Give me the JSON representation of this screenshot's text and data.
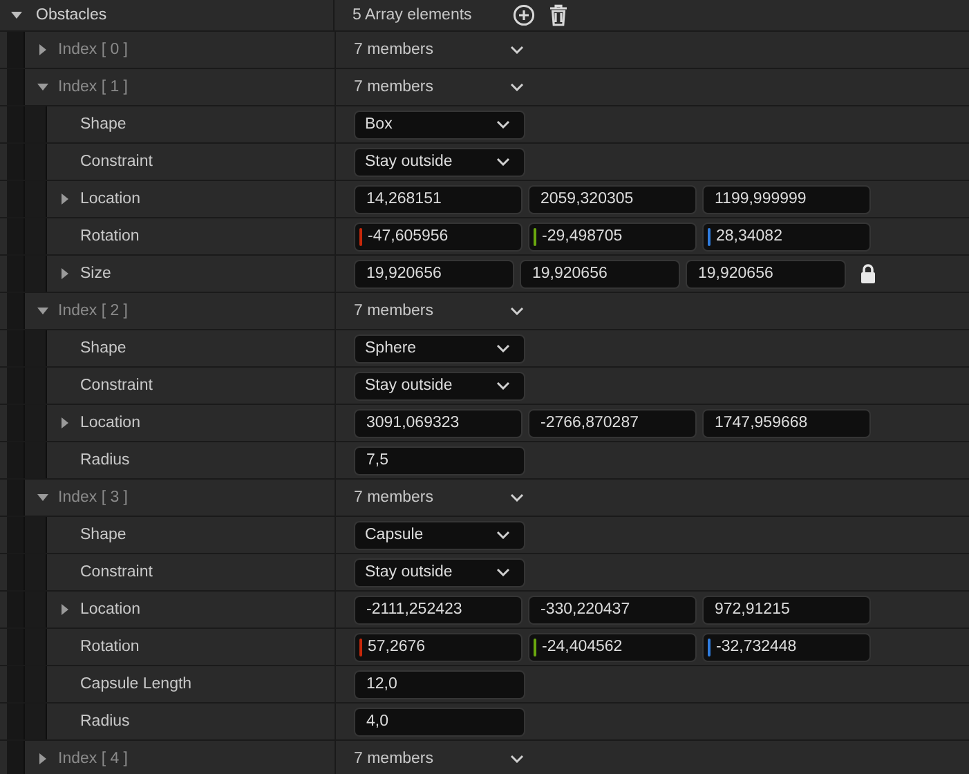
{
  "obstacles": {
    "label": "Obstacles",
    "expanded": true,
    "summary": "5 Array elements",
    "elements": [
      {
        "label": "Index [ 0 ]",
        "summary": "7 members",
        "expanded": false
      },
      {
        "label": "Index [ 1 ]",
        "summary": "7 members",
        "expanded": true,
        "members": [
          {
            "label": "Shape",
            "kind": "dropdown",
            "value": "Box"
          },
          {
            "label": "Constraint",
            "kind": "dropdown",
            "value": "Stay outside"
          },
          {
            "label": "Location",
            "kind": "vector",
            "expanded": false,
            "values": [
              "14,268151",
              "2059,320305",
              "1199,999999"
            ]
          },
          {
            "label": "Rotation",
            "kind": "rotator",
            "values": [
              "-47,605956",
              "-29,498705",
              "28,34082"
            ]
          },
          {
            "label": "Size",
            "kind": "vector",
            "expanded": false,
            "locked": true,
            "values": [
              "19,920656",
              "19,920656",
              "19,920656"
            ]
          }
        ]
      },
      {
        "label": "Index [ 2 ]",
        "summary": "7 members",
        "expanded": true,
        "members": [
          {
            "label": "Shape",
            "kind": "dropdown",
            "value": "Sphere"
          },
          {
            "label": "Constraint",
            "kind": "dropdown",
            "value": "Stay outside"
          },
          {
            "label": "Location",
            "kind": "vector",
            "expanded": false,
            "values": [
              "3091,069323",
              "-2766,870287",
              "1747,959668"
            ]
          },
          {
            "label": "Radius",
            "kind": "number",
            "value": "7,5"
          }
        ]
      },
      {
        "label": "Index [ 3 ]",
        "summary": "7 members",
        "expanded": true,
        "members": [
          {
            "label": "Shape",
            "kind": "dropdown",
            "value": "Capsule"
          },
          {
            "label": "Constraint",
            "kind": "dropdown",
            "value": "Stay outside"
          },
          {
            "label": "Location",
            "kind": "vector",
            "expanded": false,
            "values": [
              "-2111,252423",
              "-330,220437",
              "972,91215"
            ]
          },
          {
            "label": "Rotation",
            "kind": "rotator",
            "values": [
              "57,2676",
              "-24,404562",
              "-32,732448"
            ]
          },
          {
            "label": "Capsule Length",
            "kind": "number",
            "value": "12,0"
          },
          {
            "label": "Radius",
            "kind": "number",
            "value": "4,0"
          }
        ]
      },
      {
        "label": "Index [ 4 ]",
        "summary": "7 members",
        "expanded": false
      }
    ]
  }
}
